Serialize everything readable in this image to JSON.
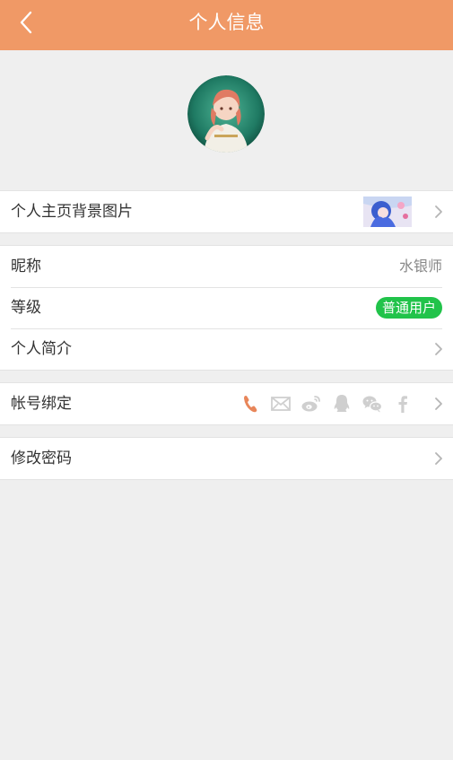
{
  "header": {
    "title": "个人信息",
    "back_icon": "chevron-left-icon",
    "color": "#f09966"
  },
  "profile": {
    "avatar": "avatar"
  },
  "section_background": {
    "label": "个人主页背景图片"
  },
  "section_info": {
    "nickname_label": "昵称",
    "nickname_value": "水银师",
    "level_label": "等级",
    "level_value": "普通用户",
    "level_color": "#21c34a",
    "bio_label": "个人简介"
  },
  "section_binding": {
    "label": "帐号绑定",
    "icons": [
      "phone-icon",
      "mail-icon",
      "weibo-icon",
      "qq-icon",
      "wechat-icon",
      "facebook-icon"
    ],
    "active_color": "#e8865a",
    "inactive_color": "#cfcfcf"
  },
  "section_password": {
    "label": "修改密码"
  }
}
